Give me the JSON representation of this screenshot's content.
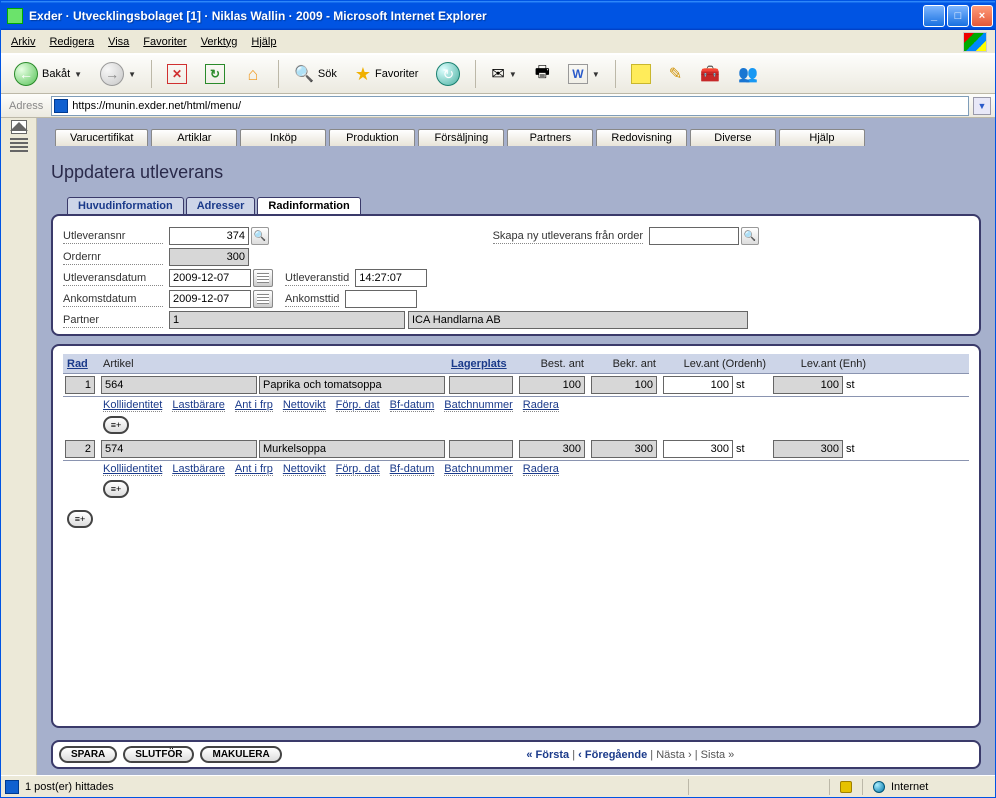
{
  "window": {
    "title": "Exder · Utvecklingsbolaget [1] · Niklas Wallin · 2009 - Microsoft Internet Explorer"
  },
  "menu": {
    "items": [
      "Arkiv",
      "Redigera",
      "Visa",
      "Favoriter",
      "Verktyg",
      "Hjälp"
    ]
  },
  "toolbar": {
    "back": "Bakåt",
    "search": "Sök",
    "favorites": "Favoriter"
  },
  "address": {
    "label": "Adress",
    "url": "https://munin.exder.net/html/menu/"
  },
  "app": {
    "tabs": [
      "Varucertifikat",
      "Artiklar",
      "Inköp",
      "Produktion",
      "Försäljning",
      "Partners",
      "Redovisning",
      "Diverse",
      "Hjälp"
    ]
  },
  "page": {
    "title": "Uppdatera utleverans"
  },
  "subtabs": {
    "items": [
      "Huvudinformation",
      "Adresser",
      "Radinformation"
    ],
    "active": 2
  },
  "form": {
    "utleveransnr_label": "Utleveransnr",
    "utleveransnr": "374",
    "ordernr_label": "Ordernr",
    "ordernr": "300",
    "utleveransdatum_label": "Utleveransdatum",
    "utleveransdatum": "2009-12-07",
    "utleveranstid_label": "Utleveranstid",
    "utleveranstid": "14:27:07",
    "ankomstdatum_label": "Ankomstdatum",
    "ankomstdatum": "2009-12-07",
    "ankomsttid_label": "Ankomsttid",
    "ankomsttid": "",
    "partner_label": "Partner",
    "partner_nr": "1",
    "partner_name": "ICA Handlarna AB",
    "skapa_label": "Skapa ny utleverans från order",
    "skapa_val": ""
  },
  "table": {
    "headers": {
      "rad": "Rad",
      "artikel": "Artikel",
      "lagerplats": "Lagerplats",
      "best_ant": "Best. ant",
      "bekr_ant": "Bekr. ant",
      "lev_ordenh": "Lev.ant (Ordenh)",
      "lev_enh": "Lev.ant (Enh)"
    },
    "subheaders": [
      "Kolliidentitet",
      "Lastbärare",
      "Ant i frp",
      "Nettovikt",
      "Förp. dat",
      "Bf-datum",
      "Batchnummer",
      "Radera"
    ],
    "rows": [
      {
        "rad": "1",
        "artnr": "564",
        "artnamn": "Paprika och tomatsoppa",
        "lager": "",
        "best": "100",
        "bekr": "100",
        "levord": "100",
        "levenh": "100",
        "unit": "st"
      },
      {
        "rad": "2",
        "artnr": "574",
        "artnamn": "Murkelsoppa",
        "lager": "",
        "best": "300",
        "bekr": "300",
        "levord": "300",
        "levenh": "300",
        "unit": "st"
      }
    ]
  },
  "footer": {
    "spara": "SPARA",
    "slutfor": "SLUTFÖR",
    "makulera": "MAKULERA",
    "forsta": "« Första",
    "foregaende": "‹ Föregående",
    "nasta": "Nästa ›",
    "sista": "Sista »"
  },
  "status": {
    "text": "1 post(er) hittades",
    "zone": "Internet"
  }
}
